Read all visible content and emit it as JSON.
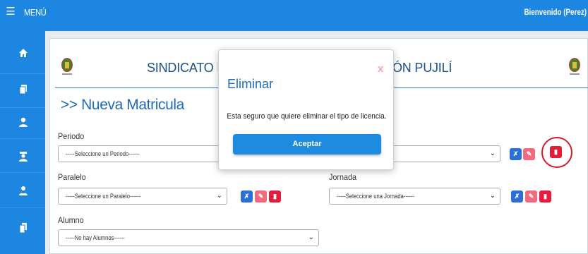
{
  "topbar": {
    "menu_icon": "hamburger-icon",
    "menu_label": "MENÚ",
    "welcome": "Bienvenido (Perez)"
  },
  "sidebar": {
    "items": [
      {
        "icon": "home-icon",
        "glyph": "⌂"
      },
      {
        "icon": "copy-icon",
        "glyph": "❐"
      },
      {
        "icon": "user-icon",
        "glyph": "●"
      },
      {
        "icon": "teacher-icon",
        "glyph": "♜"
      },
      {
        "icon": "users-icon",
        "glyph": "●"
      },
      {
        "icon": "documents-icon",
        "glyph": "❐"
      }
    ]
  },
  "header": {
    "title_left": "SINDICATO DE C",
    "title_right": "ÓN PUJILÍ"
  },
  "form": {
    "title": ">> Nueva Matricula",
    "periodo_label": "Periodo",
    "periodo_value": "-----Seleccione un Periodo------",
    "paralelo_label": "Paralelo",
    "paralelo_value": "-----Seleccione un Paralelo------",
    "jornada_label": "Jornada",
    "jornada_value": "-----Seleccione una Jornada------",
    "alumno_label": "Alumno",
    "alumno_value": "-----No hay Alumnos------"
  },
  "actions": {
    "edit_icon": "tools-icon",
    "update_icon": "edit-icon",
    "delete_icon": "trash-icon"
  },
  "modal": {
    "title": "Eliminar",
    "close": "x",
    "message": "Esta seguro que quiere eliminar el tipo de licencia.",
    "accept": "Aceptar"
  },
  "colors": {
    "primary": "#1d86e0",
    "title_blue": "#1f6bb8",
    "delete_red": "#e31d3b",
    "edit_pink": "#f4697e",
    "tool_blue": "#2b6fd9"
  }
}
